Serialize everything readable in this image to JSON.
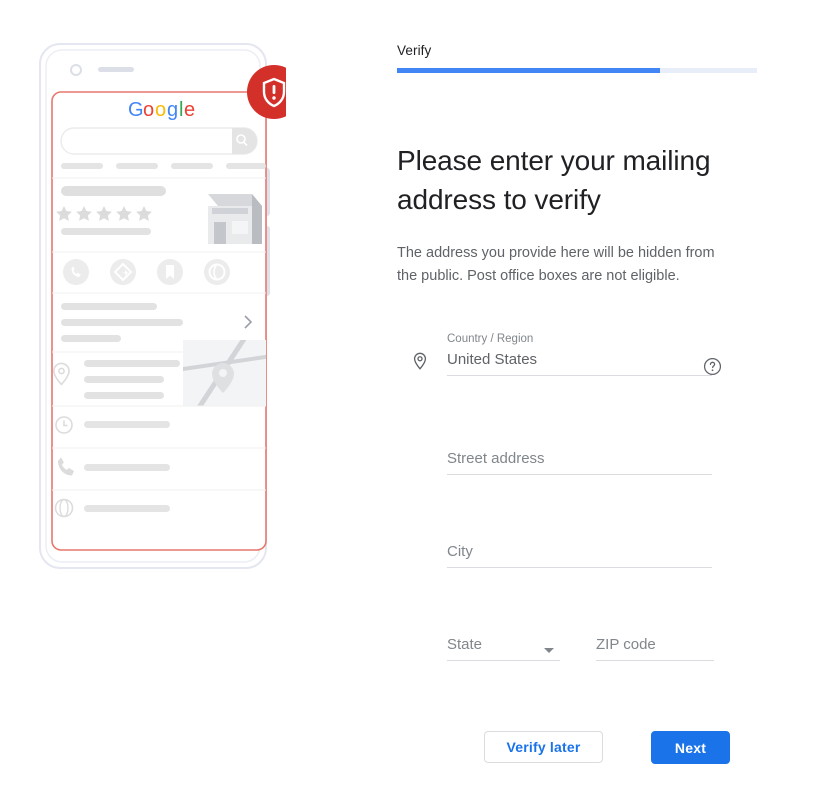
{
  "illustration": {
    "phone_mockup_name": "google-search-result-phone-mockup",
    "brand_logo_letters": [
      {
        "char": "G",
        "color": "#4285f4"
      },
      {
        "char": "o",
        "color": "#ea4335"
      },
      {
        "char": "o",
        "color": "#fbbc05"
      },
      {
        "char": "g",
        "color": "#4285f4"
      },
      {
        "char": "l",
        "color": "#34a853"
      },
      {
        "char": "e",
        "color": "#ea4335"
      }
    ],
    "badge": {
      "icon": "shield-alert-icon",
      "color": "#d93025"
    },
    "screen_border_color": "#e8776f",
    "action_icons": [
      "call-icon",
      "directions-icon",
      "bookmark-icon",
      "share-icon"
    ],
    "detail_icons": [
      "clock-icon",
      "phone-icon",
      "globe-icon"
    ],
    "rating_stars": 5
  },
  "progress": {
    "step_label": "Verify",
    "percent": 73,
    "fill_color": "#4285f4",
    "track_color": "#e8eef9"
  },
  "content": {
    "title": "Please enter your mailing address to verify",
    "description": "The address you provide here will be hidden from the public. Post office boxes are not eligible."
  },
  "form": {
    "country": {
      "label": "Country / Region",
      "value": "United States",
      "leading_icon": "location-pin-icon",
      "help_icon": "help-circle-icon"
    },
    "street": {
      "placeholder": "Street address",
      "value": ""
    },
    "city": {
      "placeholder": "City",
      "value": ""
    },
    "state": {
      "placeholder": "State",
      "value": "",
      "dropdown_icon": "chevron-down-icon"
    },
    "zip": {
      "placeholder": "ZIP code",
      "value": ""
    }
  },
  "actions": {
    "verify_later_label": "Verify later",
    "next_label": "Next",
    "primary_color": "#1a73e8"
  }
}
